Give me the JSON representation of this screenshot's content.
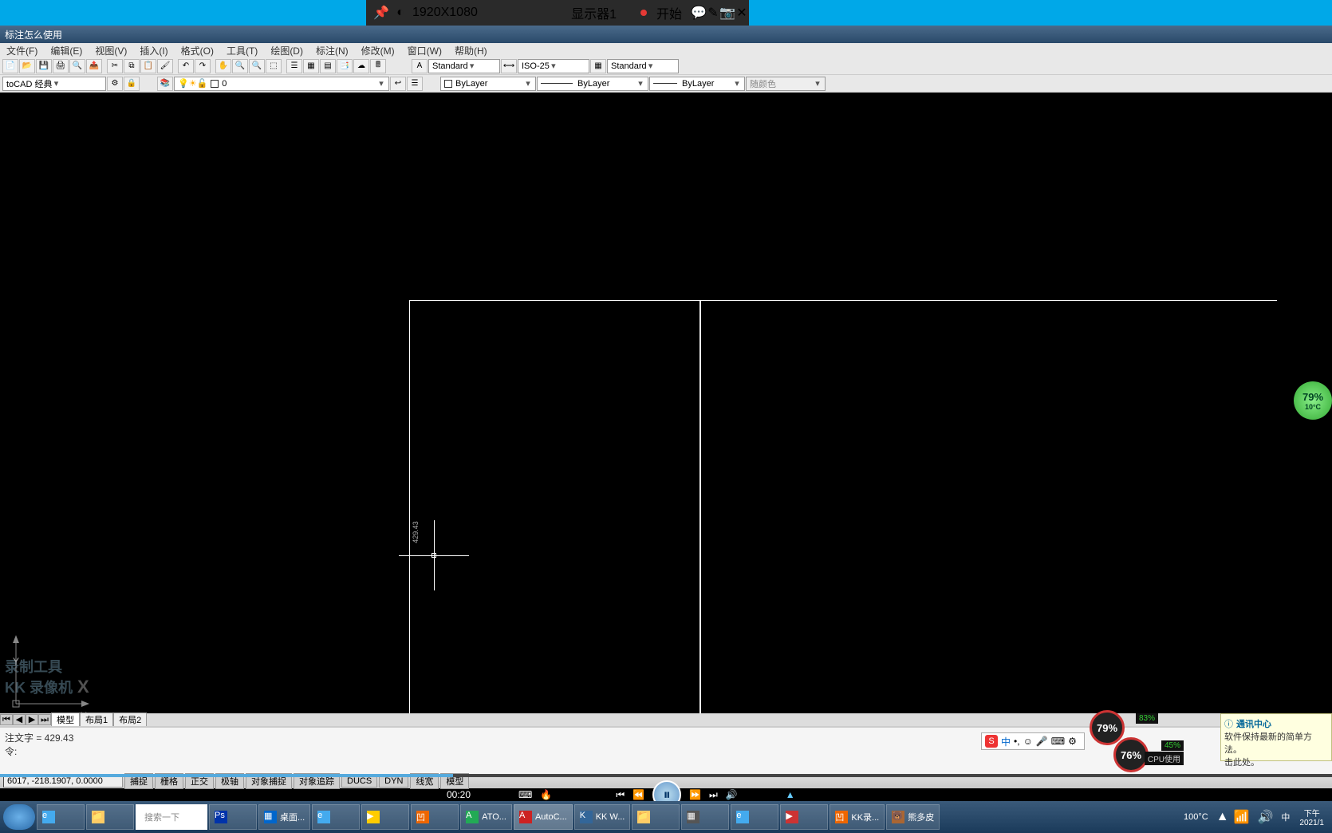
{
  "recorder": {
    "resolution": "1920X1080",
    "monitor": "显示器1",
    "start": "开始",
    "resolution2": "1920X1080",
    "monitor2": "显示器1",
    "start2": "开始"
  },
  "app": {
    "title_prefix": "标注怎么使用"
  },
  "menu": [
    "文件(F)",
    "编辑(E)",
    "视图(V)",
    "插入(I)",
    "格式(O)",
    "工具(T)",
    "绘图(D)",
    "标注(N)",
    "修改(M)",
    "窗口(W)",
    "帮助(H)"
  ],
  "toolbar1": {
    "text_style": "Standard",
    "dim_style": "ISO-25",
    "table_style": "Standard"
  },
  "toolbar2": {
    "workspace": "toCAD 经典",
    "layer": "0",
    "prop_layer": "ByLayer",
    "prop_ltype": "ByLayer",
    "prop_lwt": "ByLayer",
    "prop_color": "随颜色"
  },
  "canvas": {
    "ucs_x": "X",
    "ucs_y": "Y",
    "dim_value": "429.43",
    "watermark1": "录制工具",
    "watermark2": "KK 录像机"
  },
  "tabs": {
    "model": "模型",
    "layout1": "布局1",
    "layout2": "布局2"
  },
  "command": {
    "line1": "注文字 = 429.43",
    "prompt": "令:"
  },
  "status": {
    "coords": "6017, -218.1907, 0.0000",
    "buttons": [
      "捕捉",
      "栅格",
      "正交",
      "极轴",
      "对象捕捉",
      "对象追踪",
      "DUCS",
      "DYN",
      "线宽",
      "模型"
    ]
  },
  "player": {
    "time": "00:20"
  },
  "notif": {
    "title": "通讯中心",
    "body": "软件保持最新的简单方法。\n击此处。"
  },
  "gauges": {
    "g1": "79%",
    "g1_side": "83%",
    "g1_lbl": "CPU 使用",
    "g2": "76%",
    "g2_side": "45%",
    "g2_lbl": "CPU使用"
  },
  "temp": {
    "val": "79%",
    "deg": "10°C"
  },
  "ime": {
    "badge": "S",
    "lang": "中"
  },
  "taskbar": {
    "search_ph": "搜索一下",
    "items": [
      "Ps",
      "桌面...",
      "e",
      "",
      "",
      "ATO...",
      "AutoC...",
      "KK W...",
      "",
      "",
      "e",
      "",
      "KK录...",
      "熊多皮"
    ],
    "temp_tray": "100°C",
    "clock": "下午",
    "date": "2021/1"
  }
}
